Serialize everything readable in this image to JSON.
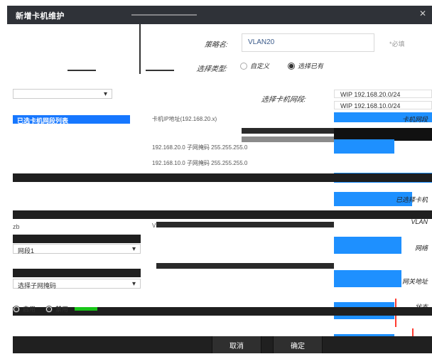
{
  "dialog": {
    "title": "新增卡机维护",
    "close_icon": "✕"
  },
  "form": {
    "policy_label": "策略名:",
    "policy_value": "VLAN20",
    "policy_hint": "*必填",
    "mode_label": "选择类型:",
    "mode_options": [
      {
        "label": "自定义",
        "checked": false
      },
      {
        "label": "选择已有",
        "checked": true
      }
    ],
    "nic_label": "选择卡机网段:"
  },
  "networks": {
    "options": [
      "WIP 192.168.20.0/24",
      "WIP 192.168.10.0/24"
    ]
  },
  "left_panel": {
    "selected_item": "已选卡机网段列表",
    "field_a": "网段1",
    "field_b": "选择子网掩码",
    "radio_a": "启用",
    "radio_b": "禁用",
    "left_short": "zb"
  },
  "middle": {
    "line1": "卡机IP地址(192.168.20.x)",
    "line2": "192.168.20.0 子网掩码 255.255.255.0",
    "line3": "192.168.10.0 子网掩码 255.255.255.0",
    "mid_small": "VLAN"
  },
  "right_panel": {
    "labels": [
      "卡机网段",
      "已选择卡机",
      "VLAN",
      "网络",
      "网关地址",
      "状态"
    ]
  },
  "footer": {
    "cancel_label": "取消",
    "ok_label": "确定"
  }
}
